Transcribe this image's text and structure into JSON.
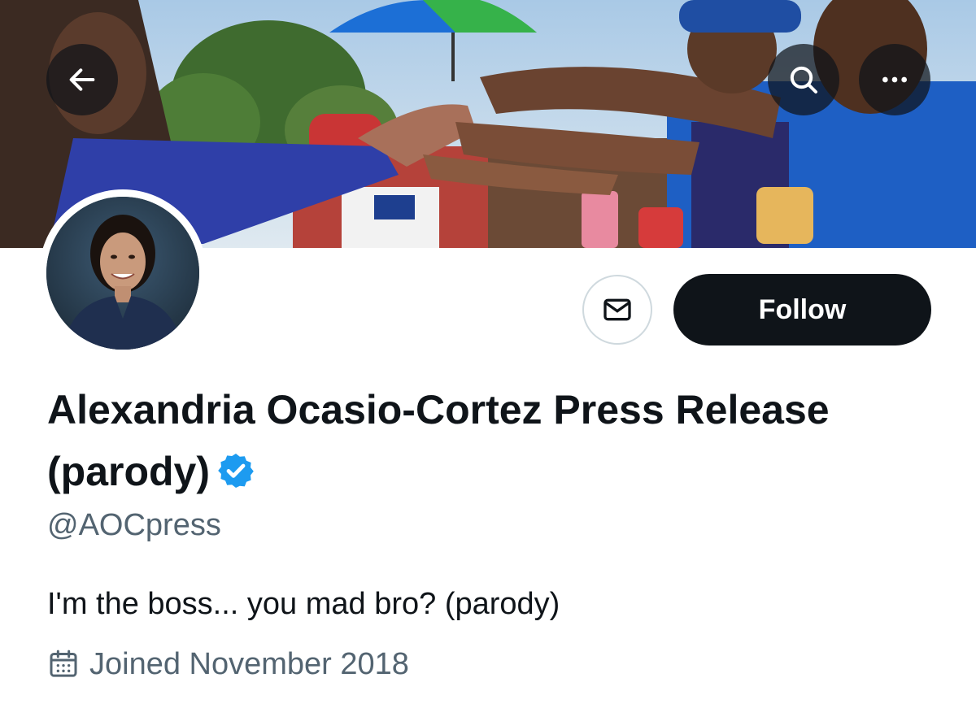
{
  "header": {
    "back_icon": "arrow-left-icon",
    "search_icon": "search-icon",
    "more_icon": "more-horizontal-icon"
  },
  "profile": {
    "display_name": "Alexandria Ocasio-Cortez Press Release (parody)",
    "verified": true,
    "handle": "@AOCpress",
    "bio": "I'm the boss... you mad bro? (parody)",
    "joined": "Joined November 2018",
    "joined_icon": "calendar-icon"
  },
  "actions": {
    "message_icon": "envelope-icon",
    "follow_label": "Follow"
  },
  "colors": {
    "text_primary": "#0f1419",
    "text_secondary": "#536471",
    "verified_blue": "#1d9bf0",
    "follow_bg": "#0f1419"
  }
}
